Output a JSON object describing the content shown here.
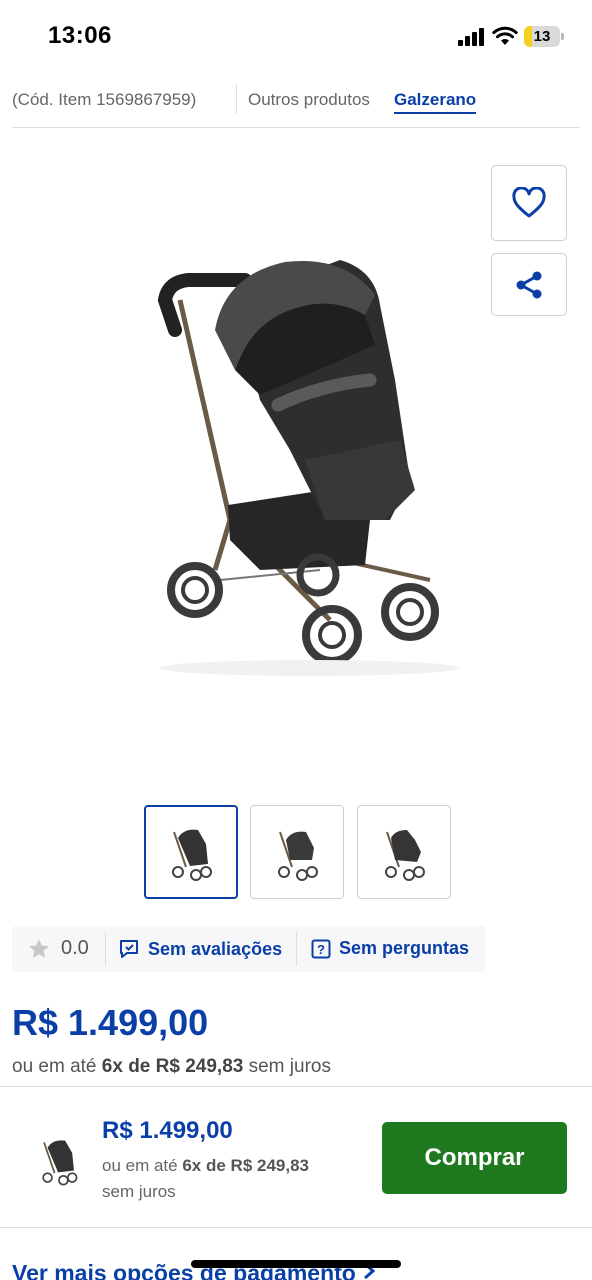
{
  "status_bar": {
    "time": "13:06",
    "battery": "13"
  },
  "item": {
    "code": "(Cód. Item 1569867959)",
    "other_products_label": "Outros produtos",
    "brand": "Galzerano"
  },
  "rating": {
    "value": "0.0",
    "reviews_label": "Sem avaliações",
    "questions_label": "Sem perguntas"
  },
  "price": {
    "main": "R$ 1.499,00",
    "inst_prefix": "ou em até",
    "inst_value": "6x de R$ 249,83",
    "inst_suffix": "sem juros"
  },
  "buy_bar": {
    "price": "R$ 1.499,00",
    "inst_prefix": "ou em até",
    "inst_value": "6x de R$ 249,83",
    "inst_suffix": "sem juros",
    "buy_label": "Comprar"
  },
  "more_payment_label": "Ver mais opções de pagamento",
  "colors": {
    "accent": "#0b3fa8",
    "buy": "#1f7a1f"
  },
  "icons": [
    "heart-icon",
    "share-icon",
    "star-icon",
    "review-icon",
    "question-icon",
    "chevron-right-icon"
  ]
}
